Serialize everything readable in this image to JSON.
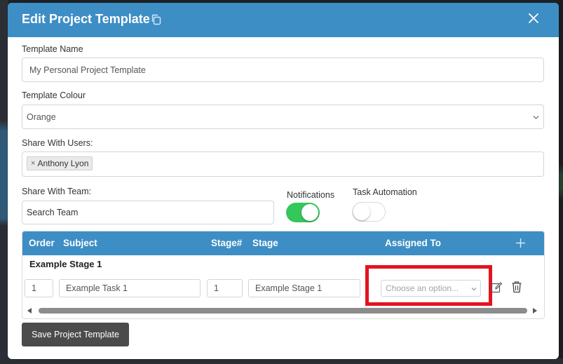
{
  "modal": {
    "title": "Edit Project Template"
  },
  "form": {
    "template_name": {
      "label": "Template Name",
      "value": "My Personal Project Template"
    },
    "template_colour": {
      "label": "Template Colour",
      "selected": "Orange"
    },
    "share_with_users": {
      "label": "Share With Users:",
      "chips": [
        {
          "remove": "×",
          "name": "Anthony Lyon"
        }
      ]
    },
    "share_with_team": {
      "label": "Share With Team:",
      "value": "Search Team"
    },
    "notifications": {
      "label": "Notifications",
      "on": true
    },
    "task_automation": {
      "label": "Task Automation",
      "on": false
    }
  },
  "table": {
    "columns": [
      "Order",
      "Subject",
      "Stage#",
      "Stage",
      "Assigned To"
    ],
    "stage_title": "Example Stage 1",
    "row": {
      "order": "1",
      "subject": "Example Task 1",
      "stage_num": "1",
      "stage": "Example Stage 1",
      "assigned_placeholder": "Choose an option..."
    }
  },
  "actions": {
    "save_label": "Save Project Template"
  },
  "colors": {
    "header": "#3d8ec4",
    "toggle_on": "#34c759",
    "highlight": "#e3141f",
    "save_button": "#4b4b4b"
  },
  "icons": [
    "copy-icon",
    "close-icon",
    "chevron-down-icon",
    "plus-icon",
    "edit-icon",
    "trash-icon",
    "scroll-left-icon",
    "scroll-right-icon"
  ]
}
